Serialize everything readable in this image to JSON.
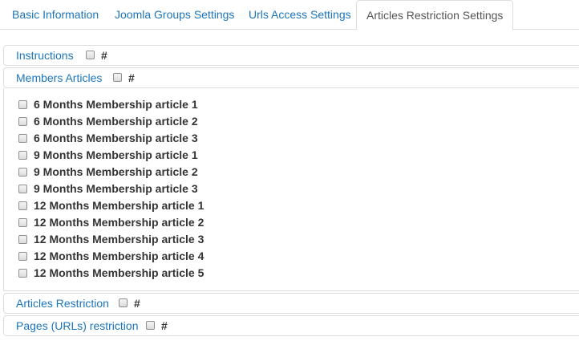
{
  "tabs": [
    {
      "label": "Basic Information"
    },
    {
      "label": "Joomla Groups Settings"
    },
    {
      "label": "Urls Access Settings"
    },
    {
      "label": "Articles Restriction Settings",
      "active": true
    }
  ],
  "panels": {
    "instructions": {
      "label": "Instructions",
      "hash": "#"
    },
    "members_articles": {
      "label": "Members Articles",
      "hash": "#"
    },
    "articles_restriction": {
      "label": "Articles Restriction",
      "hash": "#"
    },
    "pages_restriction": {
      "label": "Pages (URLs) restriction",
      "hash": "#"
    }
  },
  "articles": [
    "6 Months Membership article 1",
    "6 Months Membership article 2",
    "6 Months Membership article 3",
    "9 Months Membership article 1",
    "9 Months Membership article 2",
    "9 Months Membership article 3",
    "12 Months Membership article 1",
    "12 Months Membership article 2",
    "12 Months Membership article 3",
    "12 Months Membership article 4",
    "12 Months Membership article 5"
  ],
  "colors": {
    "link": "#1b75bb",
    "border": "#dddddd",
    "text": "#333333"
  }
}
